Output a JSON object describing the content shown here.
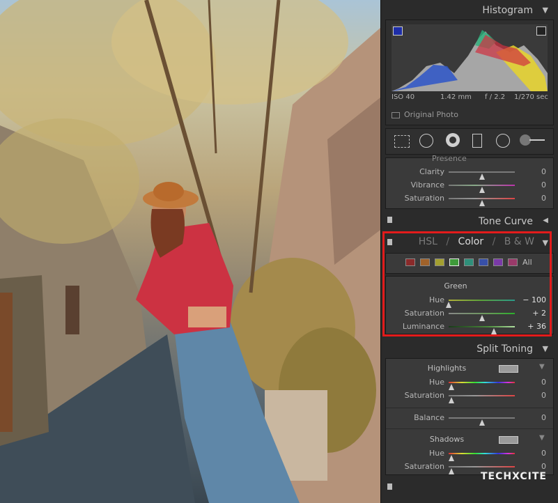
{
  "histogram": {
    "title": "Histogram",
    "iso": "ISO 40",
    "focal": "1.42 mm",
    "aperture": "f / 2.2",
    "shutter": "1/270 sec",
    "original_photo": "Original Photo"
  },
  "presence": {
    "partial_title": "Presence",
    "rows": [
      {
        "label": "Clarity",
        "value": "0"
      },
      {
        "label": "Vibrance",
        "value": "0"
      },
      {
        "label": "Saturation",
        "value": "0"
      }
    ]
  },
  "tone_curve": {
    "title": "Tone Curve"
  },
  "hsl": {
    "tab_hsl": "HSL",
    "sep1": "/",
    "tab_color": "Color",
    "sep2": "/",
    "tab_bw": "B & W",
    "all": "All",
    "swatches": [
      "#8a2a2a",
      "#a0622a",
      "#a4a030",
      "#3f9a3a",
      "#2f8f7a",
      "#3850a8",
      "#7a3aa8",
      "#9a3a6a"
    ],
    "selected_color": "Green",
    "rows": [
      {
        "label": "Hue",
        "value": "− 100",
        "level": 0.0
      },
      {
        "label": "Saturation",
        "value": "+ 2",
        "level": 0.51
      },
      {
        "label": "Luminance",
        "value": "+ 36",
        "level": 0.68
      }
    ]
  },
  "split_toning": {
    "title": "Split Toning",
    "highlights": "Highlights",
    "shadows": "Shadows",
    "hi_rows": [
      {
        "label": "Hue",
        "value": "0"
      },
      {
        "label": "Saturation",
        "value": "0"
      }
    ],
    "balance": {
      "label": "Balance",
      "value": "0"
    },
    "sh_rows": [
      {
        "label": "Hue",
        "value": "0"
      },
      {
        "label": "Saturation",
        "value": "0"
      }
    ]
  },
  "watermark": "TECHXCITE"
}
